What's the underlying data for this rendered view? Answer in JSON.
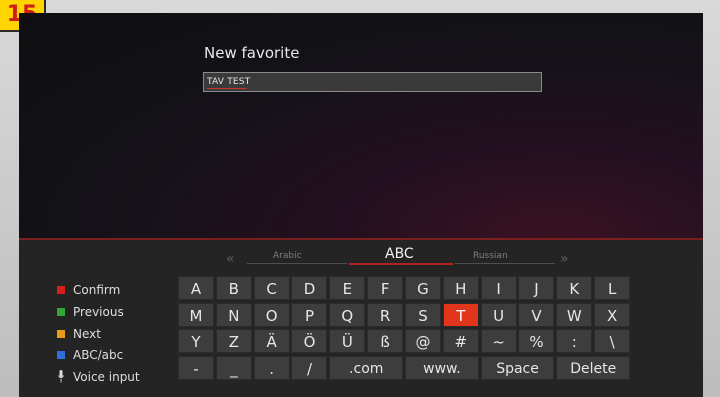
{
  "badge": "15",
  "dialog": {
    "title": "New favorite",
    "input_value": "TAV TEST"
  },
  "languages": {
    "left_arrow": "«",
    "right_arrow": "»",
    "prev": "Arabic",
    "current": "ABC",
    "next": "Russian"
  },
  "legend": [
    {
      "label": "Confirm",
      "color": "#d42020"
    },
    {
      "label": "Previous",
      "color": "#2fa83a"
    },
    {
      "label": "Next",
      "color": "#e69a1a"
    },
    {
      "label": "ABC/abc",
      "color": "#2d6fd6"
    },
    {
      "label": "Voice input",
      "icon": "microphone-icon"
    }
  ],
  "keyboard": {
    "selected_key": "T",
    "rows": [
      [
        "A",
        "B",
        "C",
        "D",
        "E",
        "F",
        "G",
        "H",
        "I",
        "J",
        "K",
        "L"
      ],
      [
        "M",
        "N",
        "O",
        "P",
        "Q",
        "R",
        "S",
        "T",
        "U",
        "V",
        "W",
        "X"
      ],
      [
        "Y",
        "Z",
        "Ä",
        "Ö",
        "Ü",
        "ß",
        "@",
        "#",
        "~",
        "%",
        ":",
        "\\"
      ],
      [
        "-",
        "_",
        ".",
        "/",
        ".com",
        "www.",
        "Space",
        "Delete"
      ]
    ]
  },
  "colors": {
    "accent": "#e2361c",
    "divider": "#7a1e1e"
  }
}
